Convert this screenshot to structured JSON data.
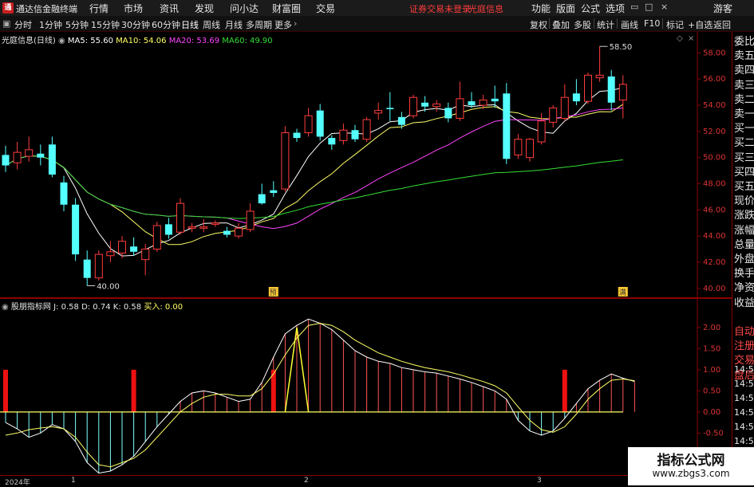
{
  "app": {
    "title": "通达信金融终端",
    "logo": "通"
  },
  "menu": {
    "items": [
      "行情",
      "市场",
      "资讯",
      "发现",
      "问小达",
      "财富圈",
      "交易"
    ],
    "center_status": "证券交易未登录",
    "center_stock": "光庭信息",
    "right_items": [
      "功能",
      "版面",
      "公式",
      "选项"
    ],
    "guest": "游客"
  },
  "toolbar": {
    "periods": [
      "分时",
      "1分钟",
      "5分钟",
      "15分钟",
      "30分钟",
      "60分钟",
      "日线",
      "周线",
      "月线",
      "多周期",
      "更多"
    ],
    "active_period": "日线",
    "right": [
      "复权",
      "叠加",
      "多股",
      "统计",
      "画线",
      "F10",
      "标记",
      "+自选",
      "返回"
    ]
  },
  "chart_header": {
    "stock": "光庭信息(日线)",
    "ma5": "MA5: 55.60",
    "ma10": "MA10: 54.06",
    "ma20": "MA20: 53.69",
    "ma60": "MA60: 49.90"
  },
  "ind_header": {
    "name": "股朋指标网",
    "j": "J: 0.58",
    "d": "D: 0.74",
    "k": "K: 0.58",
    "buy": "买入: 0.00"
  },
  "price_axis": [
    "58.00",
    "56.00",
    "54.00",
    "52.00",
    "50.00",
    "48.00",
    "46.00",
    "44.00",
    "42.00",
    "40.00"
  ],
  "ind_axis": [
    "2.00",
    "1.50",
    "1.00",
    "0.50",
    "0.00",
    "-0.50",
    "-1.00"
  ],
  "annotations": {
    "high": "58.50",
    "low": "40.00",
    "badge1": "预",
    "badge2": "满"
  },
  "date_axis": [
    "2024年",
    "1",
    "2",
    "3"
  ],
  "right_panel": [
    "委比",
    "卖五",
    "卖四",
    "卖三",
    "卖二",
    "卖一",
    "买一",
    "买二",
    "买三",
    "买四",
    "买五",
    "现价",
    "涨跌",
    "涨幅",
    "总量",
    "外盘",
    "换手",
    "净资",
    "收益",
    "",
    "自动",
    "注册",
    "交易",
    "盘后",
    "14:56",
    "14:56",
    "14:56",
    "14:56",
    "14:56",
    "14:56"
  ],
  "watermark": {
    "title": "指标公式网",
    "url": "www.zbgs3.com"
  },
  "colors": {
    "up": "#ff3c3c",
    "down": "#54ffff",
    "ma5": "#ffffff",
    "ma10": "#ffff66",
    "ma20": "#ff44ff",
    "ma60": "#33dd33"
  },
  "chart_data": {
    "type": "candlestick",
    "price_range": [
      39.5,
      59.0
    ],
    "candles": [
      {
        "o": 50.2,
        "c": 49.4,
        "h": 50.9,
        "l": 48.9
      },
      {
        "o": 49.6,
        "c": 50.4,
        "h": 51.2,
        "l": 49.1
      },
      {
        "o": 50.1,
        "c": 50.6,
        "h": 51.6,
        "l": 49.7
      },
      {
        "o": 50.3,
        "c": 50.0,
        "h": 51.0,
        "l": 49.4
      },
      {
        "o": 51.0,
        "c": 48.7,
        "h": 51.6,
        "l": 48.5
      },
      {
        "o": 48.1,
        "c": 46.4,
        "h": 48.6,
        "l": 45.9
      },
      {
        "o": 46.4,
        "c": 42.6,
        "h": 46.9,
        "l": 42.1
      },
      {
        "o": 42.2,
        "c": 40.8,
        "h": 42.9,
        "l": 40.2
      },
      {
        "o": 40.8,
        "c": 42.6,
        "h": 42.9,
        "l": 40.6
      },
      {
        "o": 42.5,
        "c": 42.8,
        "h": 43.6,
        "l": 42.0
      },
      {
        "o": 42.7,
        "c": 43.6,
        "h": 44.0,
        "l": 42.3
      },
      {
        "o": 43.2,
        "c": 42.8,
        "h": 43.9,
        "l": 42.5
      },
      {
        "o": 42.2,
        "c": 43.0,
        "h": 43.4,
        "l": 41.0
      },
      {
        "o": 43.0,
        "c": 44.8,
        "h": 45.1,
        "l": 42.8
      },
      {
        "o": 44.9,
        "c": 44.1,
        "h": 45.4,
        "l": 43.8
      },
      {
        "o": 44.3,
        "c": 46.5,
        "h": 46.9,
        "l": 44.1
      },
      {
        "o": 44.6,
        "c": 44.7,
        "h": 45.0,
        "l": 44.3
      },
      {
        "o": 44.6,
        "c": 44.7,
        "h": 45.3,
        "l": 44.3
      },
      {
        "o": 44.9,
        "c": 45.0,
        "h": 45.2,
        "l": 44.7
      },
      {
        "o": 44.4,
        "c": 44.1,
        "h": 44.7,
        "l": 43.9
      },
      {
        "o": 44.0,
        "c": 44.6,
        "h": 45.0,
        "l": 43.8
      },
      {
        "o": 44.5,
        "c": 45.9,
        "h": 46.5,
        "l": 44.3
      },
      {
        "o": 47.2,
        "c": 46.5,
        "h": 48.0,
        "l": 46.4
      },
      {
        "o": 47.5,
        "c": 47.3,
        "h": 48.2,
        "l": 47.0
      },
      {
        "o": 47.6,
        "c": 51.9,
        "h": 52.4,
        "l": 47.4
      },
      {
        "o": 51.9,
        "c": 51.5,
        "h": 52.2,
        "l": 51.2
      },
      {
        "o": 51.9,
        "c": 53.2,
        "h": 53.8,
        "l": 51.6
      },
      {
        "o": 53.6,
        "c": 51.6,
        "h": 54.1,
        "l": 51.3
      },
      {
        "o": 51.5,
        "c": 51.0,
        "h": 51.7,
        "l": 50.6
      },
      {
        "o": 51.3,
        "c": 52.1,
        "h": 52.6,
        "l": 51.0
      },
      {
        "o": 52.1,
        "c": 51.4,
        "h": 52.5,
        "l": 51.2
      },
      {
        "o": 51.4,
        "c": 52.9,
        "h": 53.1,
        "l": 51.2
      },
      {
        "o": 53.4,
        "c": 53.6,
        "h": 54.2,
        "l": 52.9
      },
      {
        "o": 53.8,
        "c": 53.7,
        "h": 55.0,
        "l": 52.8
      },
      {
        "o": 53.1,
        "c": 52.5,
        "h": 53.5,
        "l": 52.2
      },
      {
        "o": 53.2,
        "c": 54.6,
        "h": 54.8,
        "l": 53.0
      },
      {
        "o": 54.2,
        "c": 53.9,
        "h": 54.7,
        "l": 53.5
      },
      {
        "o": 53.9,
        "c": 54.1,
        "h": 54.4,
        "l": 53.5
      },
      {
        "o": 53.8,
        "c": 53.0,
        "h": 54.2,
        "l": 52.7
      },
      {
        "o": 53.0,
        "c": 54.5,
        "h": 55.8,
        "l": 52.8
      },
      {
        "o": 54.3,
        "c": 54.0,
        "h": 55.0,
        "l": 53.8
      },
      {
        "o": 54.0,
        "c": 54.4,
        "h": 54.8,
        "l": 53.7
      },
      {
        "o": 54.5,
        "c": 54.3,
        "h": 55.5,
        "l": 53.8
      },
      {
        "o": 54.9,
        "c": 49.9,
        "h": 55.7,
        "l": 49.5
      },
      {
        "o": 50.2,
        "c": 51.4,
        "h": 51.8,
        "l": 49.9
      },
      {
        "o": 50.0,
        "c": 51.4,
        "h": 51.5,
        "l": 49.7
      },
      {
        "o": 51.2,
        "c": 52.8,
        "h": 53.4,
        "l": 51.0
      },
      {
        "o": 52.7,
        "c": 53.8,
        "h": 54.0,
        "l": 52.3
      },
      {
        "o": 53.0,
        "c": 54.6,
        "h": 55.6,
        "l": 52.8
      },
      {
        "o": 54.9,
        "c": 54.3,
        "h": 56.0,
        "l": 54.0
      },
      {
        "o": 54.3,
        "c": 56.3,
        "h": 56.5,
        "l": 54.1
      },
      {
        "o": 56.1,
        "c": 56.3,
        "h": 58.5,
        "l": 55.8
      },
      {
        "o": 56.2,
        "c": 54.2,
        "h": 56.7,
        "l": 53.6
      },
      {
        "o": 54.4,
        "c": 55.6,
        "h": 56.3,
        "l": 53.0
      }
    ],
    "ind_range": [
      -1.4,
      2.3
    ],
    "k": [
      -0.25,
      -0.4,
      -0.6,
      -0.5,
      -0.3,
      -0.4,
      -0.7,
      -1.2,
      -1.45,
      -1.4,
      -1.25,
      -1.05,
      -0.7,
      -0.35,
      -0.05,
      0.25,
      0.45,
      0.5,
      0.45,
      0.35,
      0.25,
      0.3,
      0.7,
      1.3,
      1.85,
      2.05,
      2.2,
      2.1,
      1.95,
      1.7,
      1.45,
      1.3,
      1.2,
      1.15,
      1.05,
      1.0,
      0.95,
      0.92,
      0.85,
      0.78,
      0.7,
      0.6,
      0.5,
      0.3,
      -0.2,
      -0.45,
      -0.55,
      -0.45,
      -0.15,
      0.2,
      0.55,
      0.75,
      0.9,
      0.8,
      0.72
    ],
    "d": [
      -0.55,
      -0.5,
      -0.42,
      -0.38,
      -0.35,
      -0.4,
      -0.6,
      -0.95,
      -1.25,
      -1.3,
      -1.2,
      -1.1,
      -0.9,
      -0.6,
      -0.3,
      0.0,
      0.2,
      0.35,
      0.42,
      0.42,
      0.38,
      0.38,
      0.55,
      0.9,
      1.35,
      1.75,
      2.05,
      2.1,
      2.05,
      1.9,
      1.7,
      1.55,
      1.4,
      1.3,
      1.2,
      1.12,
      1.05,
      1.0,
      0.95,
      0.88,
      0.8,
      0.72,
      0.62,
      0.45,
      0.12,
      -0.2,
      -0.42,
      -0.48,
      -0.35,
      -0.05,
      0.3,
      0.55,
      0.75,
      0.78,
      0.74
    ],
    "j_spike": {
      "bar": 25,
      "value": 2.0
    },
    "buy_signals": [
      0,
      11,
      23,
      48
    ]
  }
}
